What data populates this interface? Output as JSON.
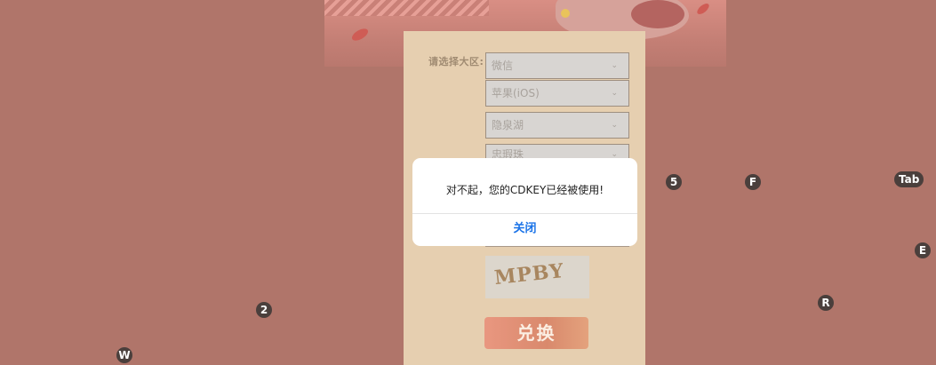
{
  "form": {
    "region_label": "请选择大区:",
    "selects": [
      {
        "value": "微信"
      },
      {
        "value": "苹果(iOS)"
      },
      {
        "value": "隐泉湖"
      },
      {
        "value": "忠瑕珠"
      }
    ],
    "captcha_text": "MPBY",
    "redeem_label": "兑换"
  },
  "dialog": {
    "message": "对不起，您的CDKEY已经被使用!",
    "close_label": "关闭"
  },
  "key_hints": {
    "k5": "5",
    "kF": "F",
    "kTab": "Tab",
    "kE": "E",
    "k2": "2",
    "kR": "R",
    "kW": "W"
  },
  "colors": {
    "overlay_bg": "#b0756a",
    "panel_bg": "#e6cfb0",
    "dialog_button": "#1a73e8"
  }
}
